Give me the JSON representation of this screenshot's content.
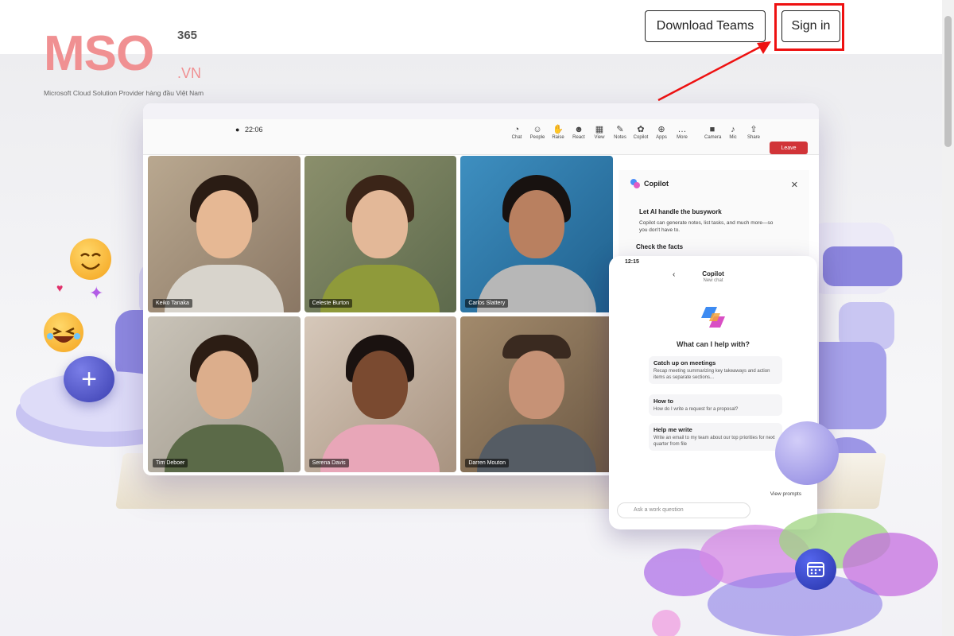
{
  "header": {
    "download_label": "Download Teams",
    "signin_label": "Sign in"
  },
  "logo": {
    "mark": "MSO",
    "superscript": "365",
    "suffix": ".VN",
    "tagline": "Microsoft Cloud Solution Provider hàng đầu Việt Nam"
  },
  "meeting": {
    "timer": "22:06",
    "toolbar": [
      "Chat",
      "People",
      "Raise",
      "React",
      "View",
      "Notes",
      "Copilot",
      "Apps",
      "More"
    ],
    "controls": [
      "Camera",
      "Mic",
      "Share"
    ],
    "leave_label": "Leave",
    "participants": [
      {
        "name": "Keiko Tanaka"
      },
      {
        "name": "Celeste Burton"
      },
      {
        "name": "Carlos Slattery"
      },
      {
        "name": "Tim Deboer"
      },
      {
        "name": "Serena Davis"
      },
      {
        "name": "Darren Mouton"
      }
    ]
  },
  "copilot_panel": {
    "title": "Copilot",
    "heading": "Let AI handle the busywork",
    "body": "Copilot can generate notes, list tasks, and much more—so you don't have to.",
    "heading2": "Check the facts"
  },
  "phone": {
    "time": "12:15",
    "title": "Copilot",
    "subtitle": "New chat",
    "prompt_question": "What can I help with?",
    "cards": [
      {
        "title": "Catch up on meetings",
        "body": "Recap meeting summarizing key takeaways and action items as separate sections..."
      },
      {
        "title": "How to",
        "body": "How do I write a request for a proposal?"
      },
      {
        "title": "Help me write",
        "body": "Write an email to my team about our top priorities for next quarter from file"
      }
    ],
    "view_prompts": "View prompts",
    "ask_placeholder": "Ask a work question"
  },
  "colors": {
    "logo_pink": "#f09092",
    "highlight_red": "#e11111",
    "accent_purple": "#5b5fc7"
  },
  "icons": [
    "smile-emoji-icon",
    "heart-icon",
    "party-icon",
    "laugh-emoji-icon",
    "plus-icon",
    "bell-icon",
    "calendar-icon"
  ]
}
